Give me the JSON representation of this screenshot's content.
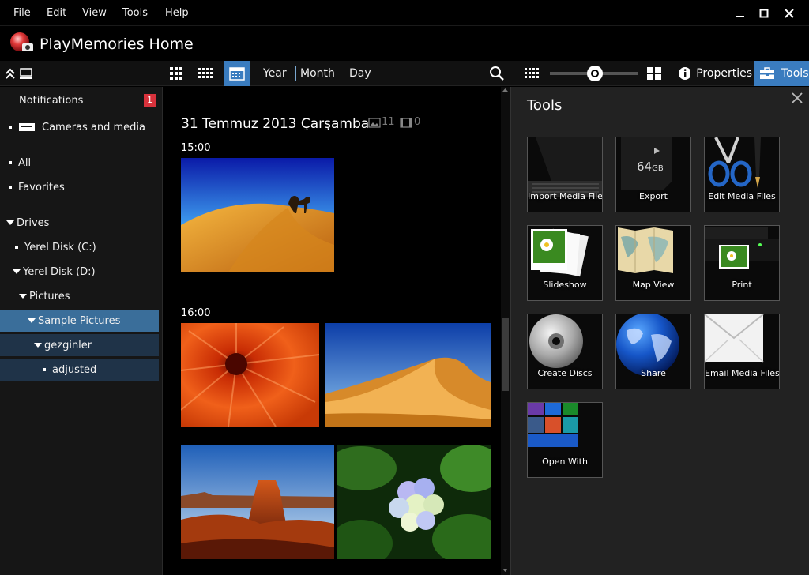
{
  "menu": {
    "items": [
      "File",
      "Edit",
      "View",
      "Tools",
      "Help"
    ]
  },
  "window": {
    "minimize_glyph": "—",
    "maximize_glyph": "□",
    "close_glyph": "✕"
  },
  "app": {
    "title": "PlayMemories Home"
  },
  "toolbar": {
    "year_label": "Year",
    "month_label": "Month",
    "day_label": "Day",
    "properties_label": "Properties",
    "tools_label": "Tools",
    "zoom_slider_value": 0.6
  },
  "sidebar": {
    "notifications": {
      "label": "Notifications",
      "count": "1"
    },
    "cameras_label": "Cameras and media",
    "all_label": "All",
    "favorites_label": "Favorites",
    "drives_label": "Drives",
    "drive_c_label": "Yerel Disk (C:)",
    "drive_d_label": "Yerel Disk (D:)",
    "pictures_label": "Pictures",
    "sample_pictures_label": "Sample Pictures",
    "gezginler_label": "gezginler",
    "adjusted_label": "adjusted"
  },
  "main": {
    "date_heading": "31 Temmuz 2013 Çarşamba",
    "photo_count": "11",
    "video_count": "0",
    "groups": [
      {
        "time": "15:00"
      },
      {
        "time": "16:00"
      }
    ]
  },
  "tools_panel": {
    "title": "Tools",
    "items": [
      {
        "label": "Import Media Files",
        "icon": "laptop-icon"
      },
      {
        "label": "Export",
        "icon": "memory-card-icon",
        "card_text": "64",
        "card_unit": "GB"
      },
      {
        "label": "Edit Media Files",
        "icon": "scissors-pen-icon"
      },
      {
        "label": "Slideshow",
        "icon": "photo-stack-icon"
      },
      {
        "label": "Map View",
        "icon": "map-icon"
      },
      {
        "label": "Print",
        "icon": "printer-icon"
      },
      {
        "label": "Create Discs",
        "icon": "disc-icon"
      },
      {
        "label": "Share",
        "icon": "globe-icon"
      },
      {
        "label": "Email Media Files",
        "icon": "envelope-icon"
      },
      {
        "label": "Open With",
        "icon": "tiles-icon"
      }
    ]
  },
  "colors": {
    "accent": "#3a6e9a",
    "badge": "#d8323c",
    "selected_dark": "#1f3348"
  }
}
